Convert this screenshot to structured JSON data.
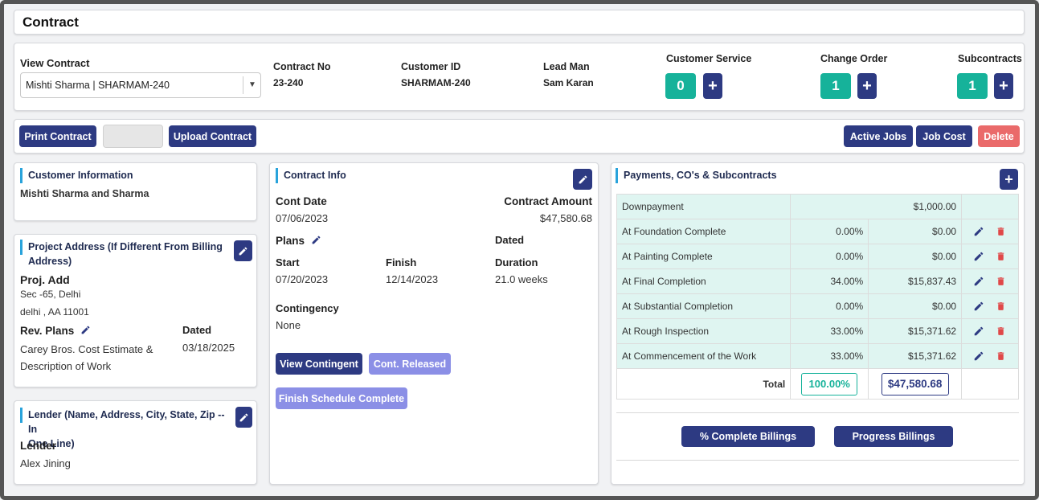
{
  "page_title": "Contract",
  "header": {
    "view_contract_label": "View Contract",
    "view_contract_value": "Mishti Sharma | SHARMAM-240",
    "contract_no_label": "Contract No",
    "contract_no_value": "23-240",
    "customer_id_label": "Customer ID",
    "customer_id_value": "SHARMAM-240",
    "lead_man_label": "Lead Man",
    "lead_man_value": "Sam Karan",
    "customer_service_label": "Customer Service",
    "customer_service_count": "0",
    "change_order_label": "Change Order",
    "change_order_count": "1",
    "subcontracts_label": "Subcontracts",
    "subcontracts_count": "1",
    "plus": "+"
  },
  "toolbar": {
    "print_contract": "Print Contract",
    "upload_contract": "Upload Contract",
    "active_jobs": "Active Jobs",
    "job_cost": "Job Cost",
    "delete": "Delete"
  },
  "customer_info": {
    "title": "Customer Information",
    "name": "Mishti Sharma and Sharma"
  },
  "project_address": {
    "title_line1": "Project Address (If Different From Billing",
    "title_line2": "Address)",
    "proj_add_label": "Proj. Add",
    "line1": "Sec -65, Delhi",
    "line2": "delhi , AA 11001",
    "rev_plans_label": "Rev. Plans",
    "rev_plans_line1": "Carey Bros. Cost Estimate &",
    "rev_plans_line2": "Description of Work",
    "dated_label": "Dated",
    "dated_value": "03/18/2025"
  },
  "lender": {
    "title_line1": "Lender (Name, Address, City, State, Zip -- In",
    "title_line2": "One Line)",
    "lender_label": "Lender",
    "lender_value": "Alex Jining"
  },
  "contract_info": {
    "title": "Contract Info",
    "cont_date_label": "Cont Date",
    "cont_date_value": "07/06/2023",
    "contract_amount_label": "Contract Amount",
    "contract_amount_value": "$47,580.68",
    "plans_label": "Plans",
    "dated_label": "Dated",
    "start_label": "Start",
    "start_value": "07/20/2023",
    "finish_label": "Finish",
    "finish_value": "12/14/2023",
    "duration_label": "Duration",
    "duration_value": "21.0 weeks",
    "contingency_label": "Contingency",
    "contingency_value": "None",
    "view_contingent": "View Contingent",
    "cont_released": "Cont. Released",
    "finish_schedule_complete": "Finish Schedule Complete"
  },
  "payments": {
    "title": "Payments, CO's & Subcontracts",
    "rows": [
      {
        "name": "Downpayment",
        "percent": "",
        "amount": "$1,000.00"
      },
      {
        "name": "At Foundation Complete",
        "percent": "0.00%",
        "amount": "$0.00"
      },
      {
        "name": "At Painting Complete",
        "percent": "0.00%",
        "amount": "$0.00"
      },
      {
        "name": "At Final Completion",
        "percent": "34.00%",
        "amount": "$15,837.43"
      },
      {
        "name": "At Substantial Completion",
        "percent": "0.00%",
        "amount": "$0.00"
      },
      {
        "name": "At Rough Inspection",
        "percent": "33.00%",
        "amount": "$15,371.62"
      },
      {
        "name": "At Commencement of the Work",
        "percent": "33.00%",
        "amount": "$15,371.62"
      }
    ],
    "total_label": "Total",
    "total_percent": "100.00%",
    "total_amount": "$47,580.68",
    "complete_billings": "% Complete Billings",
    "progress_billings": "Progress Billings"
  },
  "colors": {
    "primary": "#2d3a82",
    "teal": "#16b29a",
    "light_button": "#8b8fe6",
    "danger": "#ea6a6a",
    "row_bg": "#dff5f1"
  }
}
